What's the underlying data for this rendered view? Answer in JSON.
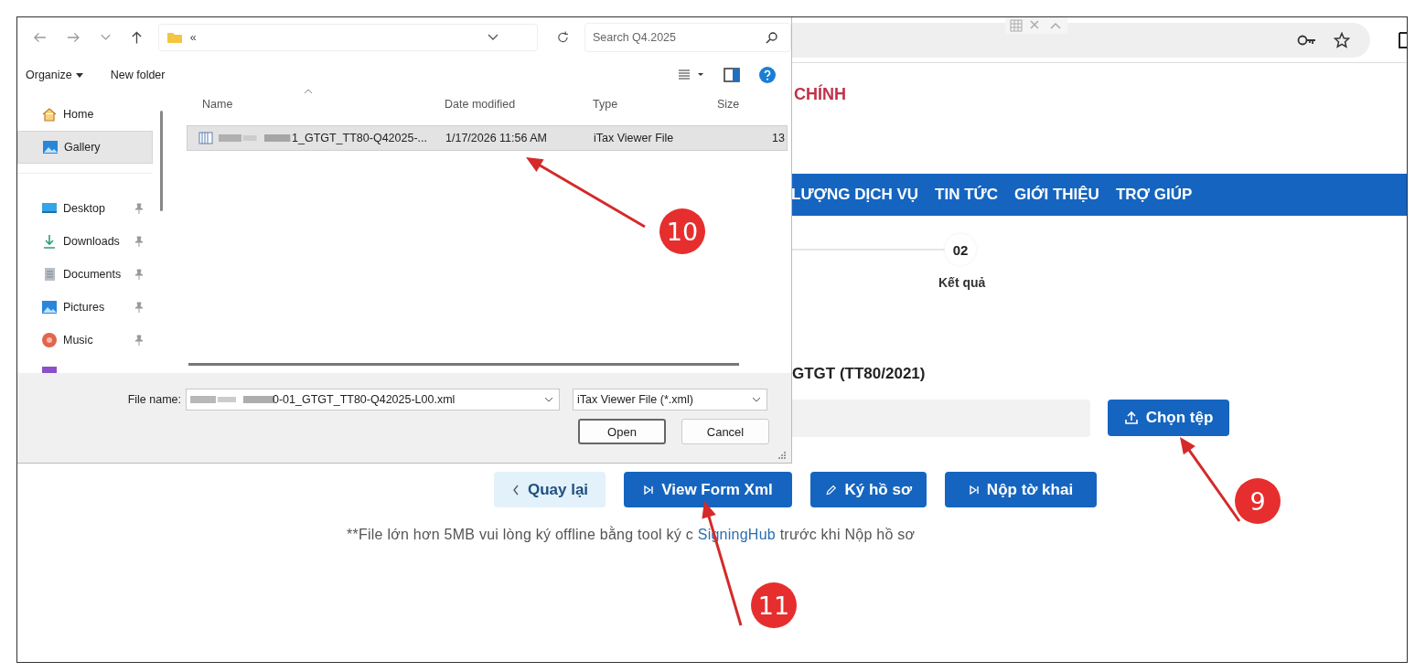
{
  "browser": {
    "header_title": "CHÍNH",
    "nav_items": [
      "LƯỢNG DỊCH VỤ",
      "TIN TỨC",
      "GIỚI THIỆU",
      "TRỢ GIÚP"
    ],
    "step": {
      "number": "02",
      "label": "Kết quả"
    },
    "section_title": "GTGT (TT80/2021)",
    "upload_button": "Chọn tệp",
    "action_buttons": [
      {
        "label": "Quay lại",
        "kind": "back"
      },
      {
        "label": "View Form Xml",
        "kind": "view"
      },
      {
        "label": "Ký hồ sơ",
        "kind": "sign"
      },
      {
        "label": "Nộp tờ khai",
        "kind": "submit"
      }
    ],
    "note": {
      "before": "**File lớn hơn 5MB vui lòng ký offline bằng tool ký c",
      "link": "SigningHub",
      "after": "trước khi Nộp hồ sơ"
    }
  },
  "dialog": {
    "address": "«",
    "search": {
      "placeholder": "Search Q4.2025"
    },
    "toolbar": [
      "Organize",
      "New folder"
    ],
    "sidebar": [
      {
        "label": "Home",
        "kind": "home",
        "pinned": false,
        "selected": false
      },
      {
        "label": "Gallery",
        "kind": "gallery",
        "pinned": false,
        "selected": true
      },
      {
        "label": "Desktop",
        "kind": "desktop",
        "pinned": true,
        "selected": false
      },
      {
        "label": "Downloads",
        "kind": "downloads",
        "pinned": true,
        "selected": false
      },
      {
        "label": "Documents",
        "kind": "documents",
        "pinned": true,
        "selected": false
      },
      {
        "label": "Pictures",
        "kind": "pictures",
        "pinned": true,
        "selected": false
      },
      {
        "label": "Music",
        "kind": "music",
        "pinned": true,
        "selected": false
      }
    ],
    "columns": [
      "Name",
      "Date modified",
      "Type",
      "Size"
    ],
    "files": [
      {
        "name": "1_GTGT_TT80-Q42025-...",
        "date": "1/17/2026 11:56 AM",
        "type": "iTax Viewer File",
        "size": "13",
        "selected": true
      }
    ],
    "file_name_label": "File name:",
    "file_name": "0-01_GTGT_TT80-Q42025-L00.xml",
    "file_type": "iTax Viewer File (*.xml)",
    "buttons": [
      "Open",
      "Cancel"
    ]
  },
  "annotations": [
    {
      "number": "10"
    },
    {
      "number": "9"
    },
    {
      "number": "11"
    }
  ]
}
